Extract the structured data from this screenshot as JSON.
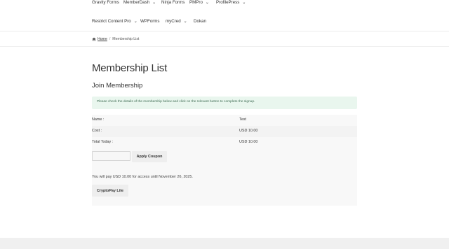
{
  "nav": {
    "row1": [
      {
        "label": "Gravity Forms",
        "has_dropdown": false
      },
      {
        "label": "MemberDash",
        "has_dropdown": true
      },
      {
        "label": "Ninja Forms",
        "has_dropdown": false
      },
      {
        "label": "PMPro",
        "has_dropdown": true
      },
      {
        "label": "ProfilePress",
        "has_dropdown": true
      }
    ],
    "row2": [
      {
        "label": "Restrict Content Pro",
        "has_dropdown": true
      },
      {
        "label": "WPForms",
        "has_dropdown": false
      },
      {
        "label": "myCred",
        "has_dropdown": true
      },
      {
        "label": "Dokan",
        "has_dropdown": false
      }
    ]
  },
  "breadcrumb": {
    "home_label": "Home",
    "separator": "/",
    "current": "Membership List"
  },
  "page": {
    "title": "Membership List",
    "section_title": "Join Membership",
    "notice": "Please check the details of the membership below and click on the relevant button to complete the signup."
  },
  "details": {
    "rows": [
      {
        "label": "Name :",
        "value": "Test"
      },
      {
        "label": "Cost :",
        "value": "USD 10.00"
      },
      {
        "label": "Total Today :",
        "value": "USD 10.00"
      }
    ]
  },
  "coupon": {
    "input_value": "",
    "input_placeholder": "",
    "button_label": "Apply Coupon"
  },
  "payment": {
    "summary": "You will pay USD 10.00 for access until November 26, 2025.",
    "button_label": "CryptoPay Lite"
  },
  "icons": {
    "home": "home-icon",
    "dropdown": "chevron-down-icon"
  },
  "colors": {
    "notice_bg": "#e9f6ee",
    "notice_text": "#3e6b52",
    "button_bg": "#eeeeee",
    "footer_bg": "#f0f0f0"
  }
}
